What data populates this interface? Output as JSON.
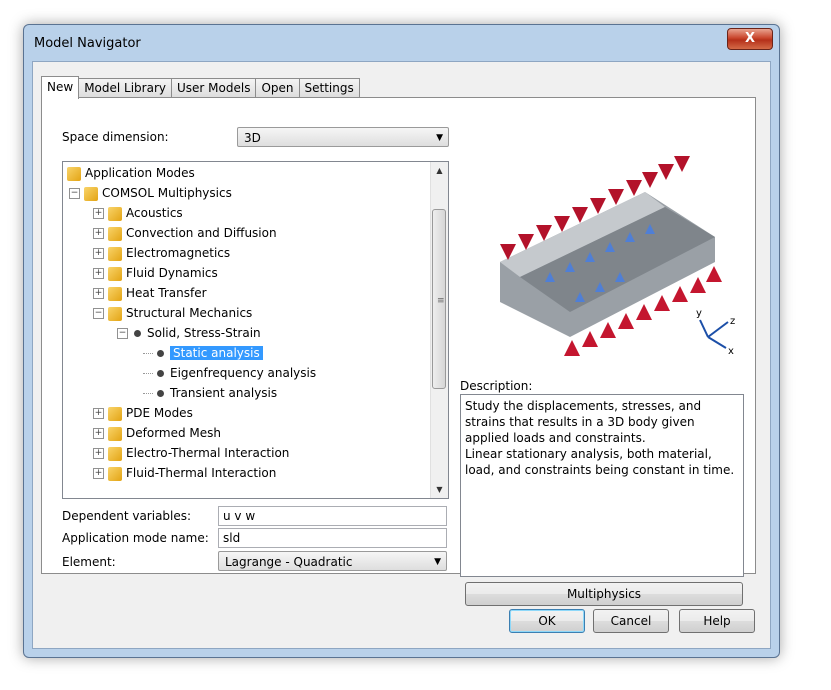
{
  "window": {
    "title": "Model Navigator",
    "close_label": "X"
  },
  "tabs": [
    {
      "label": "New",
      "active": true
    },
    {
      "label": "Model Library"
    },
    {
      "label": "User Models"
    },
    {
      "label": "Open"
    },
    {
      "label": "Settings"
    }
  ],
  "space_dimension": {
    "label": "Space dimension:",
    "value": "3D"
  },
  "tree": {
    "items": [
      {
        "label": "Application Modes"
      },
      {
        "label": "COMSOL Multiphysics"
      },
      {
        "label": "Acoustics"
      },
      {
        "label": "Convection and Diffusion"
      },
      {
        "label": "Electromagnetics"
      },
      {
        "label": "Fluid Dynamics"
      },
      {
        "label": "Heat Transfer"
      },
      {
        "label": "Structural Mechanics"
      },
      {
        "label": "Solid, Stress-Strain"
      },
      {
        "label": "Static analysis",
        "selected": true
      },
      {
        "label": "Eigenfrequency analysis"
      },
      {
        "label": "Transient analysis"
      },
      {
        "label": "PDE Modes"
      },
      {
        "label": "Deformed Mesh"
      },
      {
        "label": "Electro-Thermal Interaction"
      },
      {
        "label": "Fluid-Thermal Interaction"
      }
    ]
  },
  "fields": {
    "dependent_variables": {
      "label": "Dependent variables:",
      "value": "u v w"
    },
    "app_mode_name": {
      "label": "Application mode name:",
      "value": "sld"
    },
    "element": {
      "label": "Element:",
      "value": "Lagrange - Quadratic"
    }
  },
  "preview": {
    "axis_y": "y",
    "axis_z": "z",
    "axis_x": "x"
  },
  "description": {
    "label": "Description:",
    "line1": "Study the displacements, stresses, and",
    "line2": "strains that results in a 3D body given",
    "line3": "applied loads and constraints.",
    "line4": "Linear stationary analysis, both material,",
    "line5": "load, and constraints being constant in time."
  },
  "buttons": {
    "multiphysics": "Multiphysics",
    "ok": "OK",
    "cancel": "Cancel",
    "help": "Help"
  }
}
